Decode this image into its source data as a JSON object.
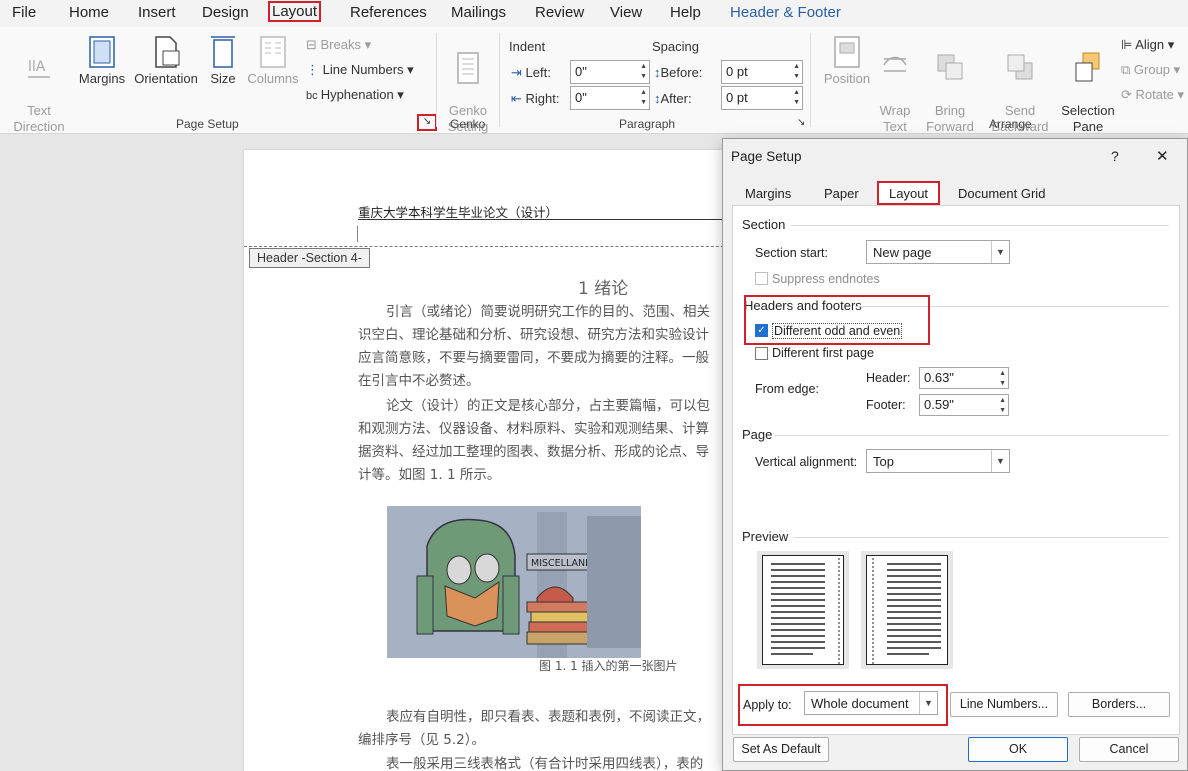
{
  "menu": {
    "items": [
      "File",
      "Home",
      "Insert",
      "Design",
      "Layout",
      "References",
      "Mailings",
      "Review",
      "View",
      "Help",
      "Header & Footer"
    ]
  },
  "ribbon": {
    "page_setup": {
      "text_direction": "Text\nDirection",
      "margins": "Margins",
      "orientation": "Orientation",
      "size": "Size",
      "columns": "Columns",
      "breaks": "Breaks",
      "line_numbers": "Line Numbers",
      "hyphenation": "Hyphenation",
      "group_label": "Page Setup"
    },
    "genko": {
      "setting": "Genko\nSetting",
      "group_label": "Genko"
    },
    "paragraph": {
      "indent_label": "Indent",
      "spacing_label": "Spacing",
      "left_label": "Left:",
      "left_value": "0\"",
      "right_label": "Right:",
      "right_value": "0\"",
      "before_label": "Before:",
      "before_value": "0 pt",
      "after_label": "After:",
      "after_value": "0 pt",
      "group_label": "Paragraph"
    },
    "arrange": {
      "position": "Position",
      "wrap_text": "Wrap\nText",
      "bring_forward": "Bring\nForward",
      "send_backward": "Send\nBackward",
      "selection_pane": "Selection\nPane",
      "align": "Align",
      "group": "Group",
      "rotate": "Rotate",
      "group_label": "Arrange"
    }
  },
  "document": {
    "header_text": "重庆大学本科学生毕业论文（设计）",
    "header_tag": "Header -Section 4-",
    "heading": "1 绪论",
    "paragraph1": [
      "引言（或绪论）简要说明研究工作的目的、范围、相关",
      "识空白、理论基础和分析、研究设想、研究方法和实验设计",
      "应言简意赅，不要与摘要雷同，不要成为摘要的注释。一般",
      "在引言中不必赘述。"
    ],
    "paragraph2": [
      "论文（设计）的正文是核心部分，占主要篇幅，可以包",
      "和观测方法、仪器设备、材料原料、实验和观测结果、计算",
      "据资料、经过加工整理的图表、数据分析、形成的论点、导",
      "计等。如图 1. 1 所示。"
    ],
    "figure_sign": "MISCELLANEA",
    "figure_caption": "图 1. 1 插入的第一张图片",
    "paragraph3": [
      "表应有自明性，即只看表、表题和表例，不阅读正文，",
      "编排序号（见 5.2）。",
      "表一般采用三线表格式（有合计时采用四线表），表的"
    ]
  },
  "dialog": {
    "title": "Page Setup",
    "help": "?",
    "close": "✕",
    "tabs": [
      "Margins",
      "Paper",
      "Layout",
      "Document Grid"
    ],
    "section": {
      "label": "Section",
      "section_start_label": "Section start:",
      "section_start_value": "New page",
      "suppress_endnotes": "Suppress endnotes"
    },
    "headers_footers": {
      "label": "Headers and footers",
      "different_odd_even": "Different odd and even",
      "different_first_page": "Different first page",
      "from_edge_label": "From edge:",
      "header_label": "Header:",
      "header_value": "0.63\"",
      "footer_label": "Footer:",
      "footer_value": "0.59\""
    },
    "page": {
      "label": "Page",
      "vertical_alignment_label": "Vertical alignment:",
      "vertical_alignment_value": "Top"
    },
    "preview": {
      "label": "Preview"
    },
    "apply_to_label": "Apply to:",
    "apply_to_value": "Whole document",
    "line_numbers_button": "Line Numbers...",
    "borders_button": "Borders...",
    "set_default_button": "Set As Default",
    "ok_button": "OK",
    "cancel_button": "Cancel"
  },
  "colors": {
    "highlight": "#d0202a",
    "accent": "#1f6fd1",
    "context_tab": "#2a5ea8"
  }
}
